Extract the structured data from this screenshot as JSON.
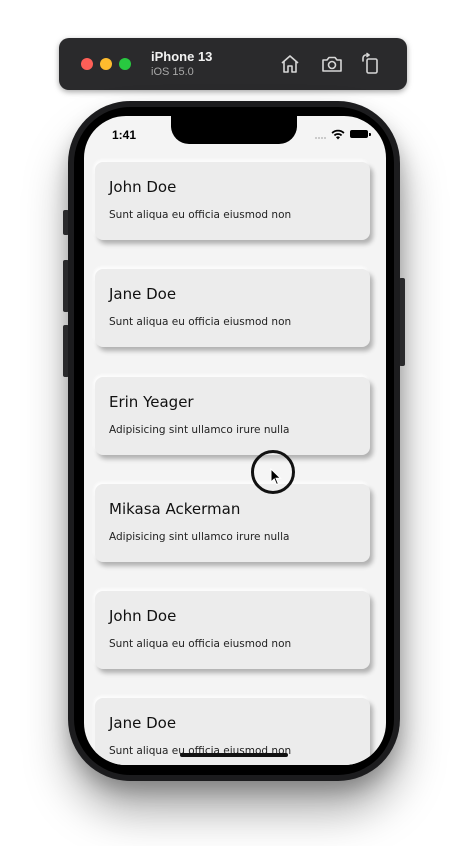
{
  "simulator": {
    "device_name": "iPhone 13",
    "os_version": "iOS 15.0",
    "buttons": [
      {
        "icon": "home-icon"
      },
      {
        "icon": "screenshot-icon"
      },
      {
        "icon": "rotate-icon"
      }
    ]
  },
  "status_bar": {
    "time": "1:41"
  },
  "cards": [
    {
      "name": "John Doe",
      "description": "Sunt aliqua eu officia eiusmod non"
    },
    {
      "name": "Jane Doe",
      "description": "Sunt aliqua eu officia eiusmod non"
    },
    {
      "name": "Erin Yeager",
      "description": "Adipisicing sint ullamco irure nulla"
    },
    {
      "name": "Mikasa Ackerman",
      "description": "Adipisicing sint ullamco irure nulla"
    },
    {
      "name": "John Doe",
      "description": "Sunt aliqua eu officia eiusmod non"
    },
    {
      "name": "Jane Doe",
      "description": "Sunt aliqua eu officia eiusmod non"
    }
  ],
  "colors": {
    "card_background": "#ececec",
    "screen_background": "#f4f4f4",
    "toolbar_background": "#2a2a2c"
  }
}
